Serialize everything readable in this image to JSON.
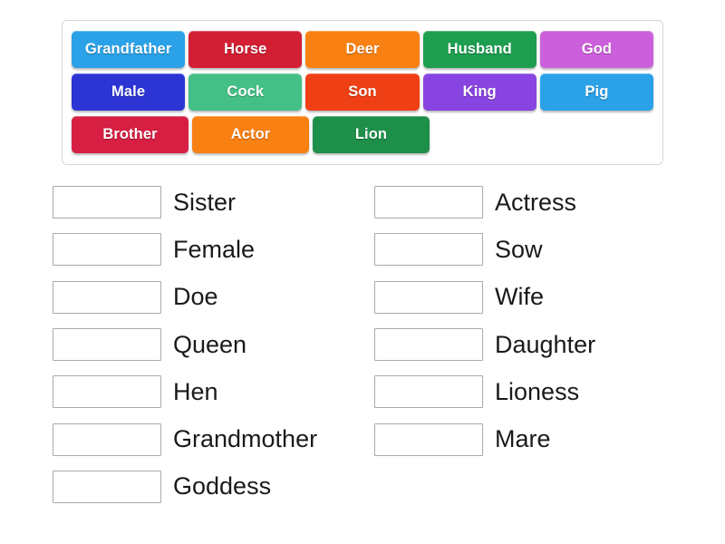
{
  "word_bank": {
    "name": "word-bank",
    "rows": [
      [
        {
          "label": "Grandfather",
          "color": "#2ba2e8"
        },
        {
          "label": "Horse",
          "color": "#d21f33"
        },
        {
          "label": "Deer",
          "color": "#f98012"
        },
        {
          "label": "Husband",
          "color": "#1e9e4f"
        },
        {
          "label": "God",
          "color": "#cc5fdb"
        }
      ],
      [
        {
          "label": "Male",
          "color": "#2c35d4"
        },
        {
          "label": "Cock",
          "color": "#44bf86"
        },
        {
          "label": "Son",
          "color": "#ef3f14"
        },
        {
          "label": "King",
          "color": "#8844e0"
        },
        {
          "label": "Pig",
          "color": "#2ba2e8"
        }
      ],
      [
        {
          "label": "Brother",
          "color": "#d61f42"
        },
        {
          "label": "Actor",
          "color": "#f98012"
        },
        {
          "label": "Lion",
          "color": "#1e8f49"
        }
      ]
    ]
  },
  "answers": {
    "left_column": [
      {
        "label": "Sister",
        "value": ""
      },
      {
        "label": "Female",
        "value": ""
      },
      {
        "label": "Doe",
        "value": ""
      },
      {
        "label": "Queen",
        "value": ""
      },
      {
        "label": "Hen",
        "value": ""
      },
      {
        "label": "Grandmother",
        "value": ""
      },
      {
        "label": "Goddess",
        "value": ""
      }
    ],
    "right_column": [
      {
        "label": "Actress",
        "value": ""
      },
      {
        "label": "Sow",
        "value": ""
      },
      {
        "label": "Wife",
        "value": ""
      },
      {
        "label": "Daughter",
        "value": ""
      },
      {
        "label": "Lioness",
        "value": ""
      },
      {
        "label": "Mare",
        "value": ""
      }
    ]
  }
}
